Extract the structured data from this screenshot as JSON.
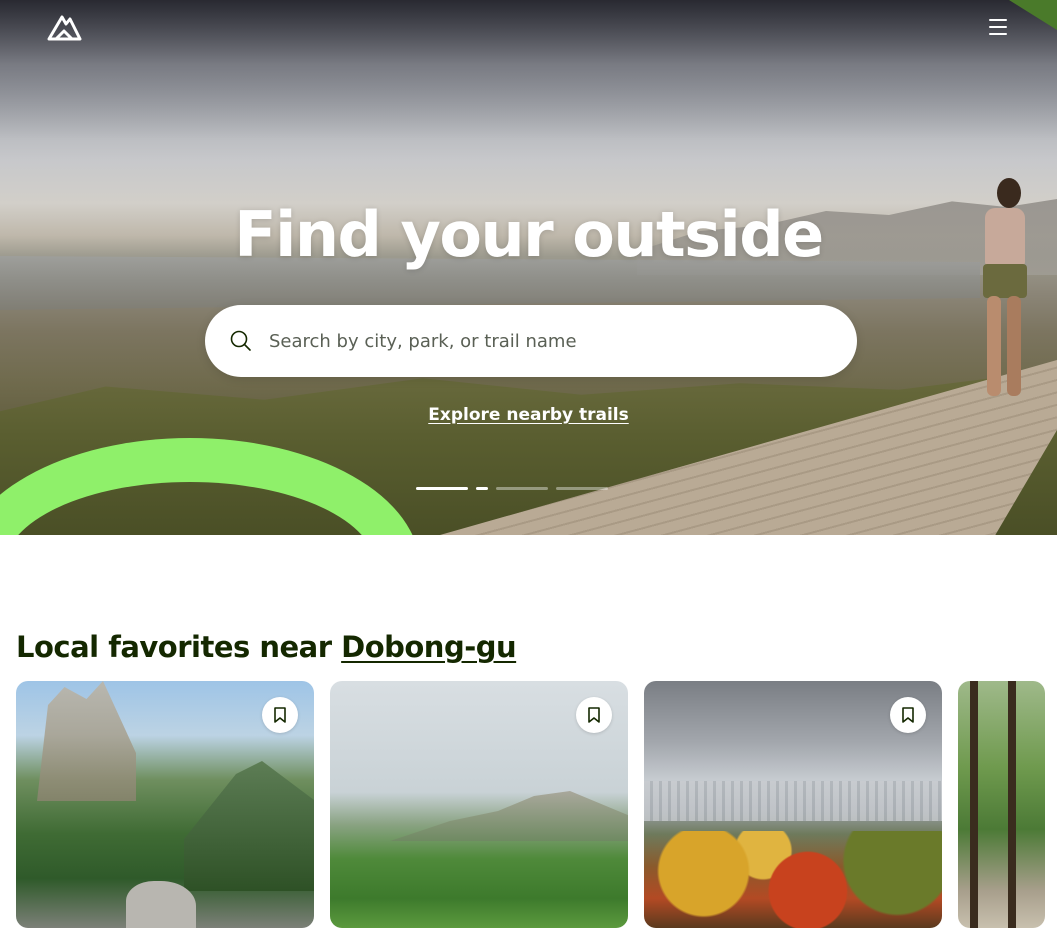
{
  "header": {
    "logo_name": "alltrails-logo",
    "menu_icon": "hamburger-menu-icon"
  },
  "hero": {
    "title": "Find your outside",
    "search": {
      "placeholder": "Search by city, park, or trail name",
      "value": ""
    },
    "explore_link": "Explore nearby trails",
    "carousel": {
      "slide_count": 5,
      "active_index": 0
    }
  },
  "local_favorites": {
    "title_prefix": "Local favorites near ",
    "location": "Dobong-gu",
    "cards": [
      {
        "bookmark_icon": "bookmark-icon"
      },
      {
        "bookmark_icon": "bookmark-icon"
      },
      {
        "bookmark_icon": "bookmark-icon"
      },
      {}
    ]
  },
  "colors": {
    "accent_green": "#8ff06a",
    "text_dark": "#142800",
    "white": "#ffffff"
  }
}
